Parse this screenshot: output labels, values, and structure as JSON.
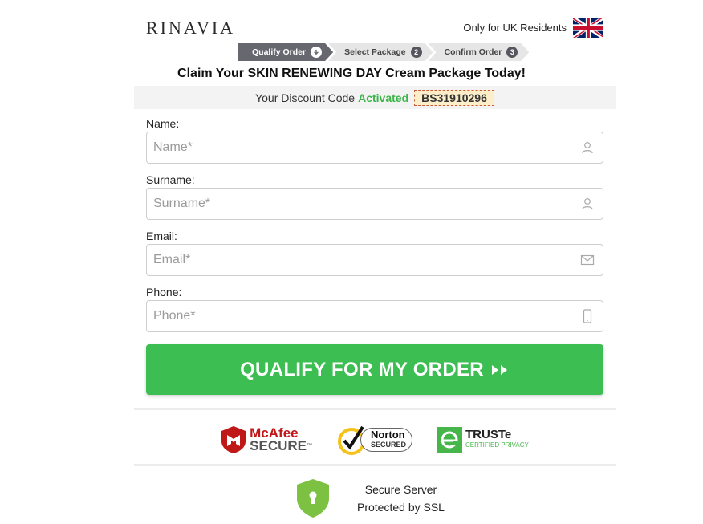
{
  "header": {
    "logo": "RINAVIA",
    "residents": "Only for UK Residents",
    "flag_icon": "uk-flag-icon"
  },
  "steps": [
    {
      "label": "Qualify Order",
      "icon": "arrow-down-circle-icon",
      "active": true
    },
    {
      "label": "Select Package",
      "number": "2",
      "active": false
    },
    {
      "label": "Confirm Order",
      "number": "3",
      "active": false
    }
  ],
  "headline": "Claim Your SKIN RENEWING DAY Cream Package Today!",
  "discount": {
    "prefix": "Your Discount Code",
    "status": "Activated",
    "code": "BS31910296"
  },
  "form": {
    "name": {
      "label": "Name:",
      "placeholder": "Name*",
      "icon": "user-icon"
    },
    "surname": {
      "label": "Surname:",
      "placeholder": "Surname*",
      "icon": "user-icon"
    },
    "email": {
      "label": "Email:",
      "placeholder": "Email*",
      "icon": "envelope-icon"
    },
    "phone": {
      "label": "Phone:",
      "placeholder": "Phone*",
      "icon": "mobile-phone-icon"
    }
  },
  "cta": {
    "label": "QUALIFY FOR MY ORDER",
    "icon": "double-chevron-right-icon"
  },
  "badges": {
    "mcafee": {
      "line1": "McAfee",
      "line2": "SECURE",
      "tm": "™"
    },
    "norton": {
      "line1": "Norton",
      "line2": "SECURED"
    },
    "truste": {
      "line1": "TRUSTe",
      "line2": "CERTIFIED PRIVACY"
    }
  },
  "ssl": {
    "line1": "Secure Server",
    "line2": "Protected by SSL",
    "icon": "shield-lock-icon"
  },
  "colors": {
    "accent_green": "#3dbe52",
    "active_step": "#67676f",
    "code_border": "#c85a3a",
    "code_bg": "#fbeec9"
  }
}
